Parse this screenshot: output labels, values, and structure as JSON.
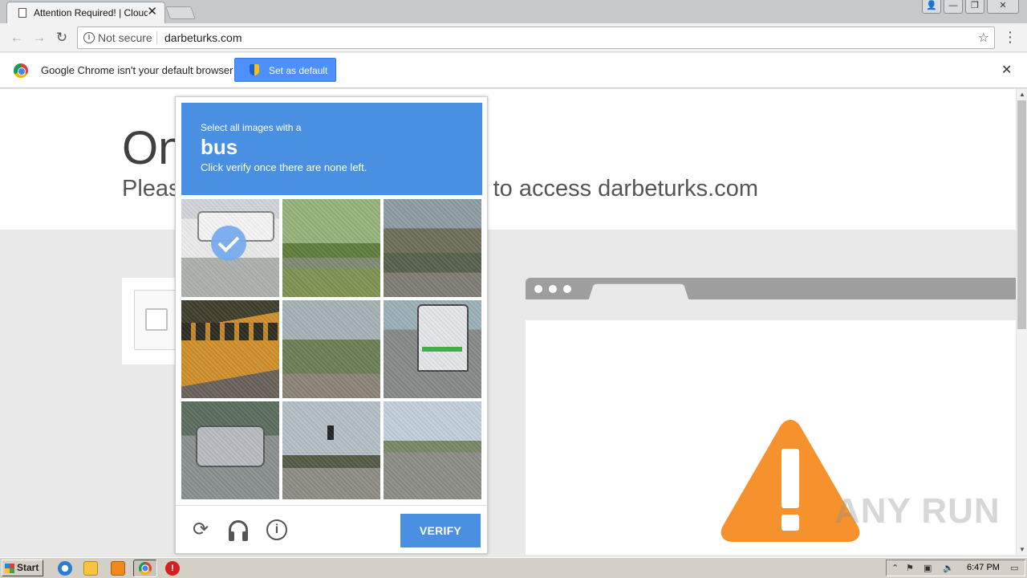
{
  "browser": {
    "tab_title": "Attention Required! | Cloudflare",
    "tab_close": "✕",
    "url_secure_label": "Not secure",
    "url": "darbeturks.com",
    "win_buttons": [
      "👤",
      "—",
      "❐",
      "✕"
    ]
  },
  "infobar": {
    "message": "Google Chrome isn't your default browser",
    "button_label": "Set as default",
    "close": "✕"
  },
  "page": {
    "heading": "One more step",
    "subheading": "Please complete the security check to access darbeturks.com"
  },
  "captcha": {
    "instruction": "Select all images with a",
    "target": "bus",
    "hint": "Click verify once there are none left.",
    "tiles": [
      {
        "selected": true
      },
      {
        "selected": false
      },
      {
        "selected": false
      },
      {
        "selected": false
      },
      {
        "selected": false
      },
      {
        "selected": false
      },
      {
        "selected": false
      },
      {
        "selected": false
      },
      {
        "selected": false
      }
    ],
    "verify_label": "VERIFY",
    "reload_icon": "⟳",
    "info_icon": "i"
  },
  "watermark": "ANY RUN",
  "taskbar": {
    "start_label": "Start",
    "clock": "6:47 PM",
    "stop_icon": "!"
  },
  "colors": {
    "captcha_blue": "#4a90e2",
    "warning_orange": "#f6922d",
    "infobar_button": "#4d90fe"
  }
}
